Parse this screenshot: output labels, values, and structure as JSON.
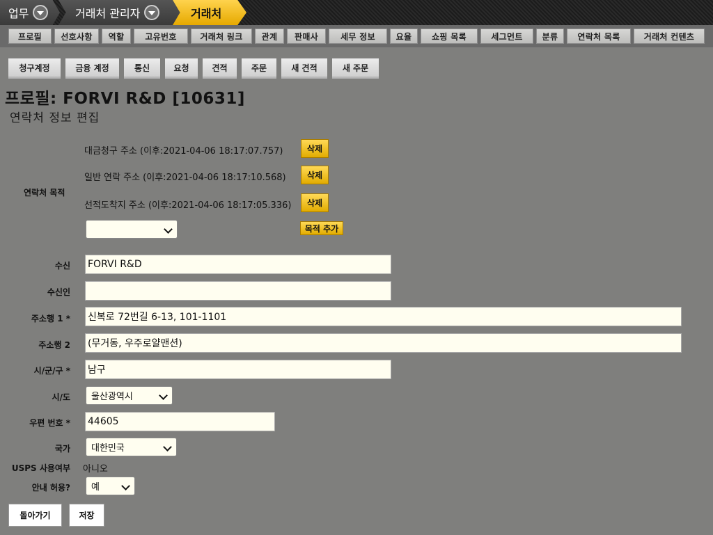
{
  "breadcrumb": {
    "item1": "업무",
    "item2": "거래처 관리자",
    "item3": "거래처"
  },
  "tabs": [
    "프로필",
    "선호사항",
    "역할",
    "고유번호",
    "거래처 링크",
    "관계",
    "판매사",
    "세무 정보",
    "요율",
    "쇼핑 목록",
    "세그먼트",
    "분류",
    "연락처 목록",
    "거래처 컨텐츠"
  ],
  "subtabs": [
    "청구계정",
    "금융 계정",
    "통신",
    "요청",
    "견적",
    "주문",
    "새 견적",
    "새 주문"
  ],
  "title": "프로필: FORVI R&D [10631]",
  "subtitle": "연락처 정보 편집",
  "purpose": {
    "label": "연락처 목적",
    "items": [
      {
        "text": "대금청구 주소 (이후:2021-04-06 18:17:07.757)",
        "button": "삭제"
      },
      {
        "text": "일반 연락 주소 (이후:2021-04-06 18:17:10.568)",
        "button": "삭제"
      },
      {
        "text": "선적도착지 주소 (이후:2021-04-06 18:17:05.336)",
        "button": "삭제"
      }
    ],
    "select_value": "",
    "add_button": "목적 추가"
  },
  "form": {
    "to_label": "수신",
    "to_value": "FORVI R&D",
    "attn_label": "수신인",
    "attn_value": "",
    "addr1_label": "주소행 1 *",
    "addr1_value": "신복로 72번길 6-13, 101-1101",
    "addr2_label": "주소행 2",
    "addr2_value": "(무거동, 우주로얄맨션)",
    "city_label": "시/군/구 *",
    "city_value": "남구",
    "state_label": "시/도",
    "state_value": "울산광역시",
    "zip_label": "우편 번호 *",
    "zip_value": "44605",
    "country_label": "국가",
    "country_value": "대한민국",
    "usps_label": "USPS 사용여부",
    "usps_value": "아니오",
    "solicit_label": "안내 허용?",
    "solicit_value": "예"
  },
  "buttons": {
    "back": "돌아가기",
    "save": "저장"
  }
}
